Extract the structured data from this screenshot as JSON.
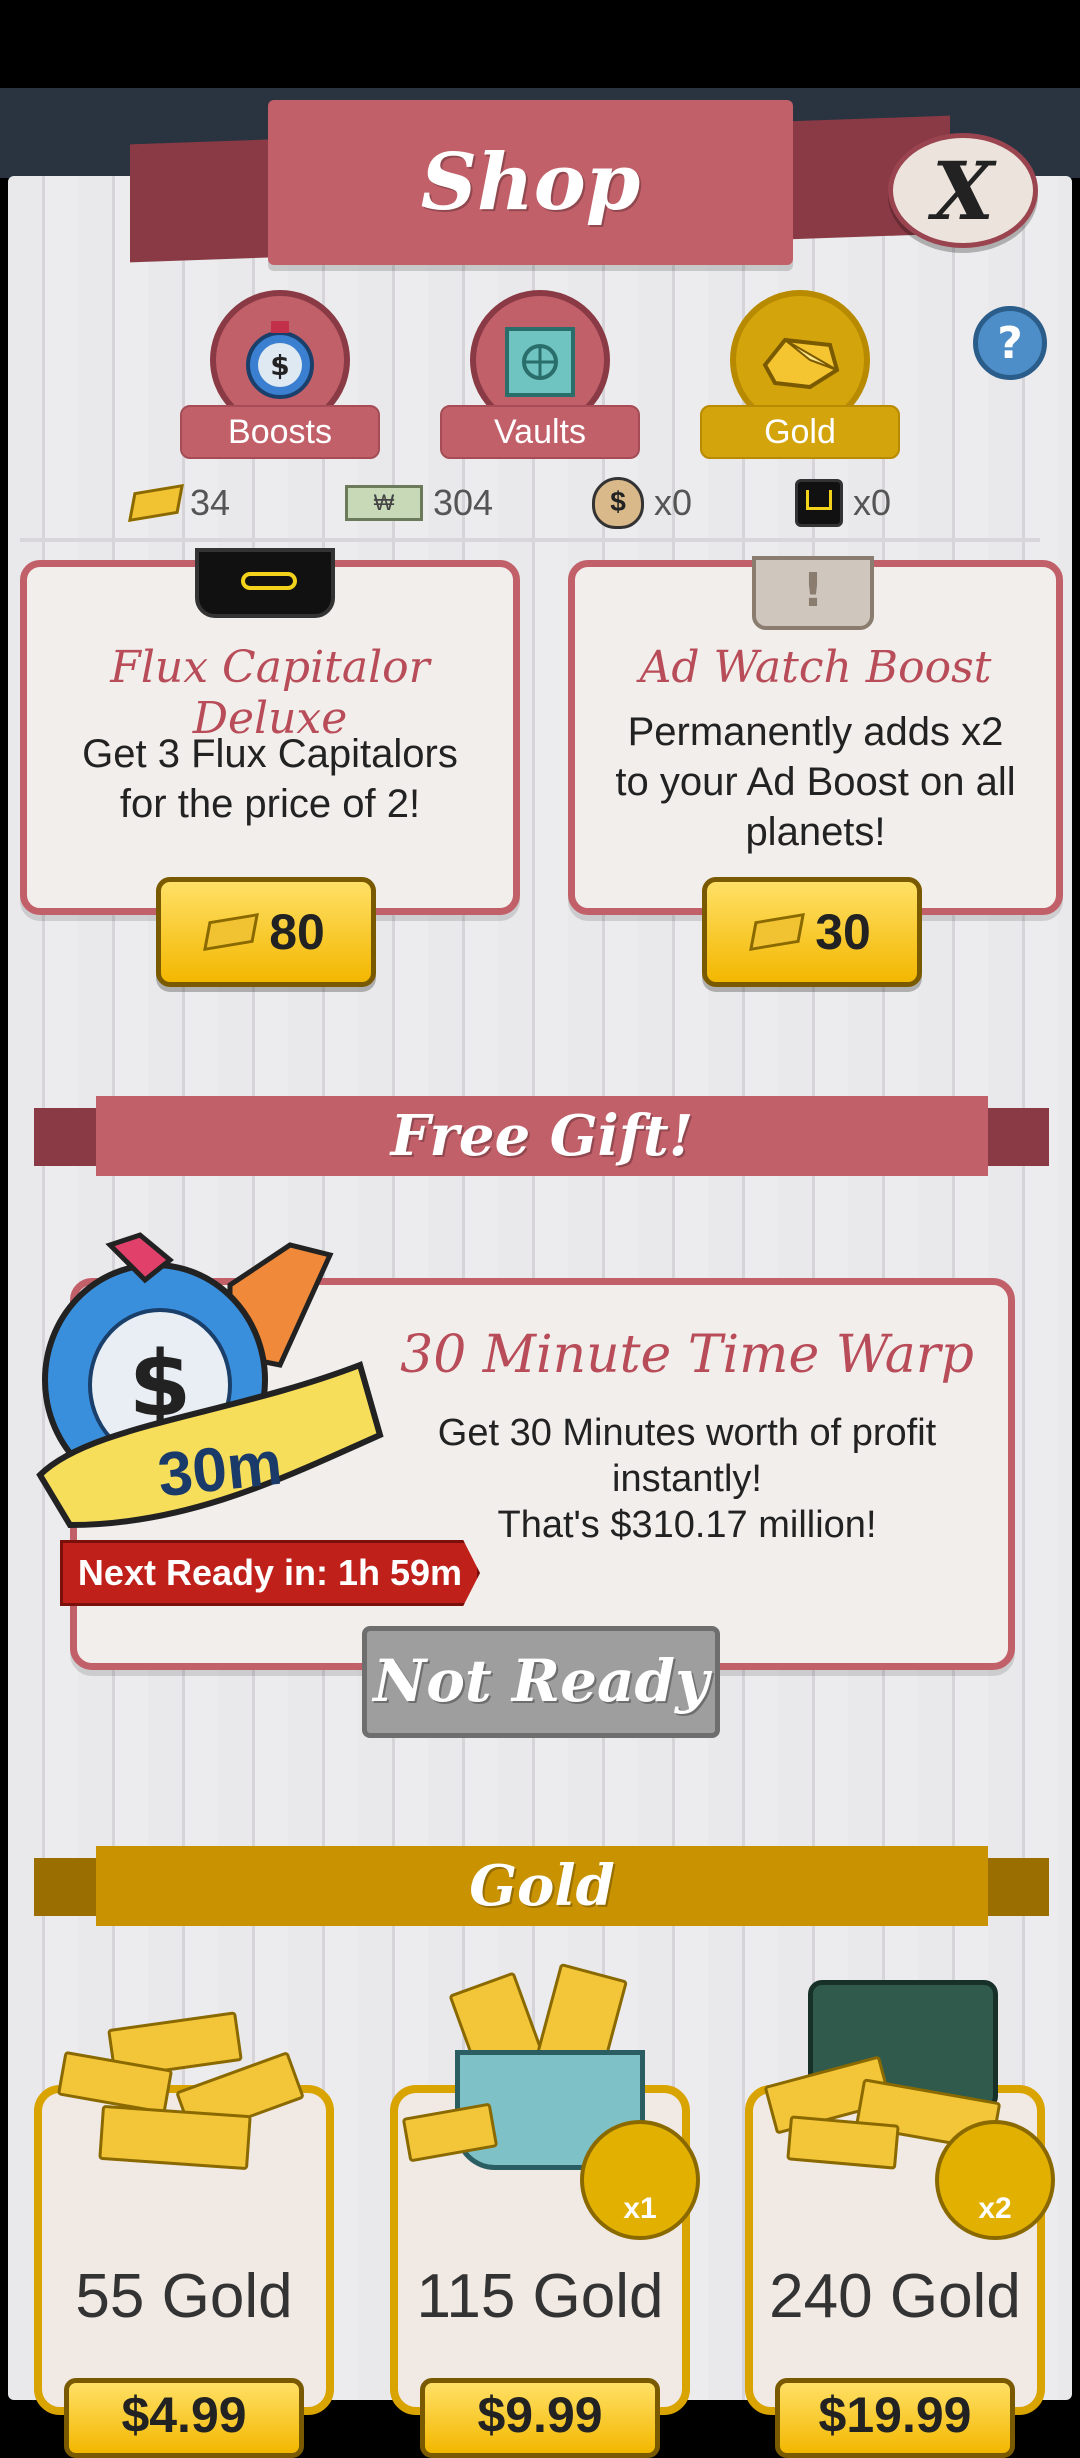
{
  "header": {
    "title": "Shop",
    "close_label": "X",
    "help_label": "?"
  },
  "tabs": [
    {
      "label": "Boosts",
      "icon": "stopwatch-icon",
      "active": false
    },
    {
      "label": "Vaults",
      "icon": "vault-icon",
      "active": false
    },
    {
      "label": "Gold",
      "icon": "gold-icon",
      "active": true
    }
  ],
  "currencies": [
    {
      "icon": "gold-icon",
      "value": "34"
    },
    {
      "icon": "megabucks-icon",
      "value": "304"
    },
    {
      "icon": "money-bag-icon",
      "value": "x0"
    },
    {
      "icon": "flux-capacitor-icon",
      "value": "x0"
    }
  ],
  "offers": [
    {
      "title": "Flux Capitalor Deluxe",
      "body": [
        "Get 3 Flux Capitalors",
        "for the price of 2!"
      ],
      "price": "80"
    },
    {
      "title": "Ad Watch Boost",
      "body": [
        "Permanently adds x2",
        "to your Ad Boost on all",
        "planets!"
      ],
      "price": "30"
    }
  ],
  "free_gift": {
    "section_title": "Free Gift!",
    "badge": "30m",
    "timer": "Next Ready in: 1h 59m",
    "title": "30 Minute Time Warp",
    "body": [
      "Get 30 Minutes worth of profit",
      "instantly!",
      "That's $310.17 million!"
    ],
    "button": "Not Ready"
  },
  "gold_section": {
    "title": "Gold",
    "packs": [
      {
        "amount": "55 Gold",
        "price": "$4.99",
        "multiplier": ""
      },
      {
        "amount": "115 Gold",
        "price": "$9.99",
        "multiplier": "x1"
      },
      {
        "amount": "240 Gold",
        "price": "$19.99",
        "multiplier": "x2"
      }
    ]
  },
  "colors": {
    "accent": "#c2606a",
    "gold": "#d4a40c",
    "timer": "#c0201a"
  }
}
